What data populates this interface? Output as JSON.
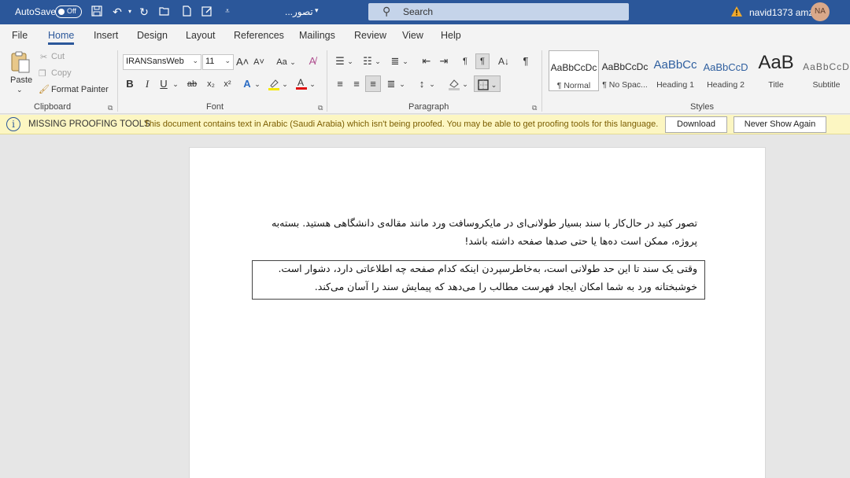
{
  "titlebar": {
    "autosave_label": "AutoSave",
    "autosave_state": "Off",
    "doc_title": "تصور...",
    "search_placeholder": "Search",
    "user_name": "navid1373 amz",
    "user_initials": "NA"
  },
  "tabs": [
    {
      "label": "File"
    },
    {
      "label": "Home"
    },
    {
      "label": "Insert"
    },
    {
      "label": "Design"
    },
    {
      "label": "Layout"
    },
    {
      "label": "References"
    },
    {
      "label": "Mailings"
    },
    {
      "label": "Review"
    },
    {
      "label": "View"
    },
    {
      "label": "Help"
    }
  ],
  "ribbon": {
    "clipboard": {
      "paste": "Paste",
      "cut": "Cut",
      "copy": "Copy",
      "format_painter": "Format Painter",
      "label": "Clipboard"
    },
    "font": {
      "family": "IRANSansWeb",
      "size": "11",
      "label": "Font",
      "change_case": "Aa"
    },
    "paragraph": {
      "label": "Paragraph"
    },
    "styles": {
      "label": "Styles",
      "items": [
        {
          "sample": "AaBbCcDc",
          "name": "¶ Normal"
        },
        {
          "sample": "AaBbCcDc",
          "name": "¶ No Spac..."
        },
        {
          "sample": "AaBbCc",
          "name": "Heading 1"
        },
        {
          "sample": "AaBbCcD",
          "name": "Heading 2"
        },
        {
          "sample": "AaB",
          "name": "Title"
        },
        {
          "sample": "AaBbCcD",
          "name": "Subtitle"
        }
      ]
    }
  },
  "infobar": {
    "title": "MISSING PROOFING TOOLS",
    "message": "This document contains text in Arabic (Saudi Arabia) which isn't being proofed. You may be able to get proofing tools for this language.",
    "download": "Download",
    "never_show": "Never Show Again"
  },
  "document": {
    "para1_line1": "تصور کنید در حال‌کار با سند بسیار طولانی‌ای در مایکروسافت ورد مانند مقاله‌ی دانشگاهی هستید. بسته‌به",
    "para1_line2": "پروژه، ممکن است ده‌ها یا حتی صدها صفحه داشته باشد!",
    "para2_line1": "وقتی یک سند تا این حد طولانی است، به‌خاطرسپردن اینکه کدام صفحه چه اطلاعاتی دارد، دشوار است.",
    "para2_line2": "خوشبختانه ورد به شما امکان ایجاد فهرست مطالب را می‌دهد که پیمایش سند را آسان می‌کند."
  }
}
